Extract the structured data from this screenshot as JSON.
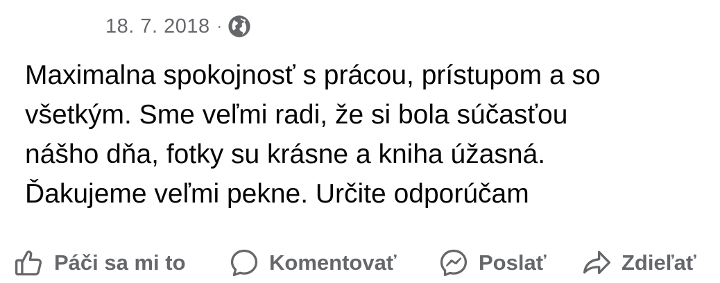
{
  "post": {
    "date": "18. 7. 2018",
    "separator": "·",
    "visibility_icon": "globe-icon",
    "text_lines": [
      "Maximalna spokojnosť s prácou, prístupom a so",
      "všetkým. Sme veľmi radi, že si bola súčasťou",
      "nášho dňa, fotky su krásne a kniha úžasná.",
      "Ďakujeme veľmi pekne. Určite odporúčam"
    ]
  },
  "actions": {
    "like": {
      "label": "Páči sa mi to",
      "icon": "thumbs-up-icon"
    },
    "comment": {
      "label": "Komentovať",
      "icon": "speech-bubble-icon"
    },
    "send": {
      "label": "Poslať",
      "icon": "messenger-icon"
    },
    "share": {
      "label": "Zdieľať",
      "icon": "share-arrow-icon"
    }
  },
  "colors": {
    "text": "#050505",
    "secondary": "#65676b",
    "background": "#ffffff"
  }
}
